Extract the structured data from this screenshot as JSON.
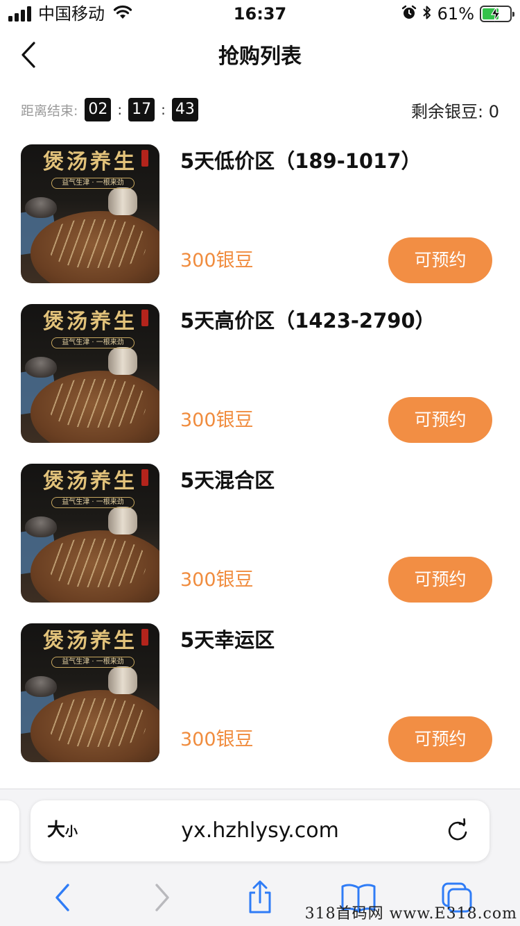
{
  "status_bar": {
    "carrier": "中国移动",
    "time": "16:37",
    "battery_percent": "61%",
    "battery_level": 0.61,
    "icons": [
      "signal-icon",
      "wifi-icon",
      "alarm-icon",
      "bluetooth-icon",
      "battery-charging-icon"
    ]
  },
  "header": {
    "title": "抢购列表",
    "back_icon": "chevron-left-icon"
  },
  "countdown": {
    "label": "距离结束:",
    "hours": "02",
    "minutes": "17",
    "seconds": "43",
    "separator": ":"
  },
  "balance": {
    "label": "剩余银豆: 0"
  },
  "product_image": {
    "brand_text": "煲汤养生",
    "slogan": "益气生津 · 一根来劲"
  },
  "items": [
    {
      "name": "5天低价区（189-1017）",
      "price": "300银豆",
      "button": "可预约"
    },
    {
      "name": "5天高价区（1423-2790）",
      "price": "300银豆",
      "button": "可预约"
    },
    {
      "name": "5天混合区",
      "price": "300银豆",
      "button": "可预约"
    },
    {
      "name": "5天幸运区",
      "price": "300银豆",
      "button": "可预约"
    }
  ],
  "browser": {
    "text_size_big": "大",
    "text_size_small": "小",
    "url": "yx.hzhlysy.com",
    "toolbar_icons": [
      "back-icon",
      "forward-icon",
      "share-icon",
      "bookmarks-icon",
      "tabs-icon"
    ]
  },
  "watermark": "318首码网 www.E318.com",
  "colors": {
    "accent": "#f28e44",
    "price": "#f08c3e",
    "ios_blue": "#2f7cf6"
  }
}
